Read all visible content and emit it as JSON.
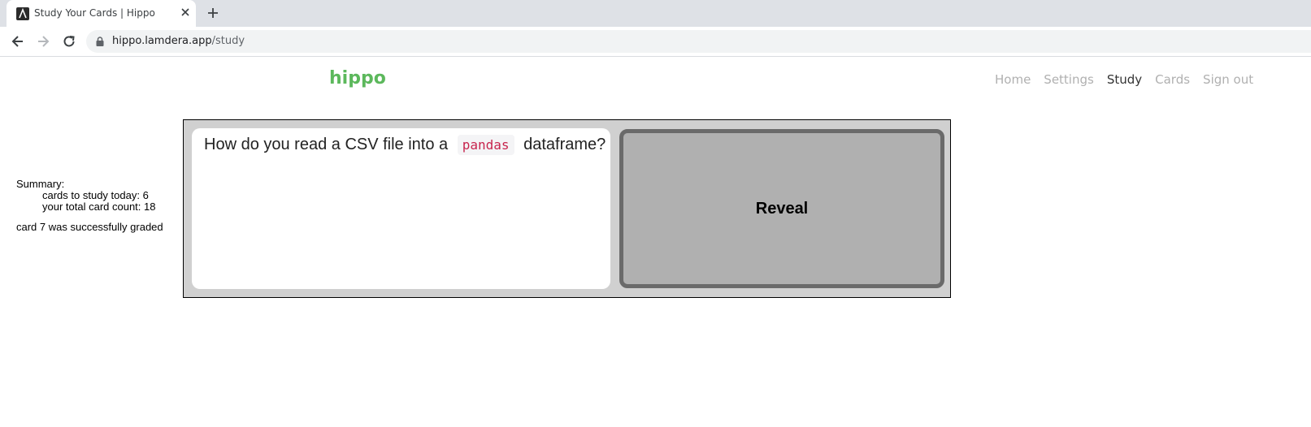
{
  "browser": {
    "tab_title": "Study Your Cards | Hippo",
    "url_host": "hippo.lamdera.app",
    "url_path": "/study"
  },
  "header": {
    "brand": "hippo",
    "nav": {
      "home": "Home",
      "settings": "Settings",
      "study": "Study",
      "cards": "Cards",
      "sign_out": "Sign out"
    }
  },
  "summary": {
    "heading": "Summary:",
    "cards_today": "cards to study today: 6",
    "total_cards": "your total card count: 18",
    "graded_message": "card 7 was successfully graded"
  },
  "card": {
    "question_before": "How do you read a CSV file into a",
    "question_code": "pandas",
    "question_after": "dataframe?",
    "reveal_label": "Reveal"
  },
  "colors": {
    "brand": "#5cb85c",
    "nav_inactive": "#b0b0b0",
    "nav_active": "#333333",
    "code_text": "#c7254e"
  }
}
